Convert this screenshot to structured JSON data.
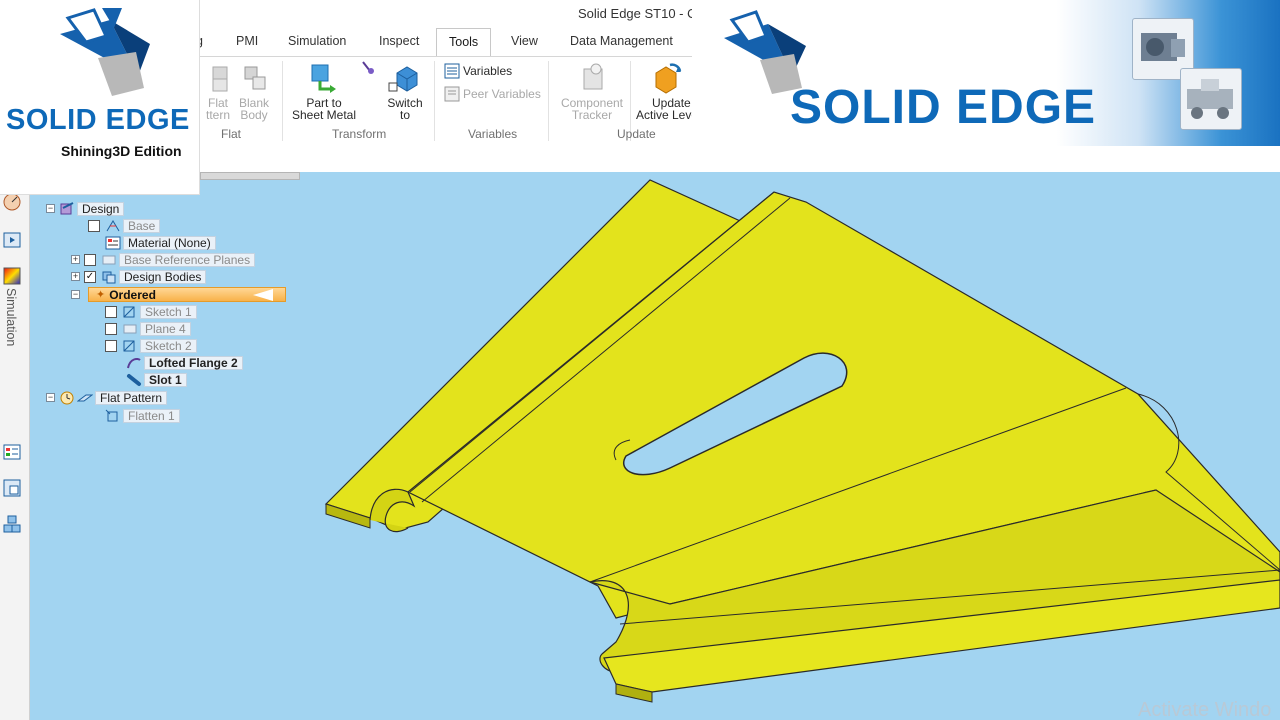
{
  "window": {
    "title": "Solid Edge ST10 - O"
  },
  "tabs": [
    {
      "label": "g",
      "active": false
    },
    {
      "label": "PMI",
      "active": false
    },
    {
      "label": "Simulation",
      "active": false
    },
    {
      "label": "Inspect",
      "active": false
    },
    {
      "label": "Tools",
      "active": true
    },
    {
      "label": "View",
      "active": false
    },
    {
      "label": "Data Management",
      "active": false
    }
  ],
  "ribbon": {
    "flat_group": {
      "flat_pattern_line1": "Flat",
      "flat_pattern_line2": "ttern",
      "blank_body_line1": "Blank",
      "blank_body_line2": "Body",
      "group_label": "Flat"
    },
    "transform_group": {
      "part_to_sheet_line1": "Part to",
      "part_to_sheet_line2": "Sheet Metal",
      "switch_to_line1": "Switch",
      "switch_to_line2": "to",
      "group_label": "Transform"
    },
    "variables_group": {
      "variables": "Variables",
      "peer_variables": "Peer Variables",
      "group_label": "Variables"
    },
    "update_group": {
      "component_tracker_line1": "Component",
      "component_tracker_line2": "Tracker",
      "update_active_line1": "Update",
      "update_active_line2": "Active Leve",
      "group_label": "Update"
    }
  },
  "logo_left": {
    "brand": "SOLID EDGE",
    "edition": "Shining3D Edition"
  },
  "banner": {
    "brand": "SOLID EDGE"
  },
  "left_strip": {
    "vertical_label": "Simulation"
  },
  "tree": {
    "design": "Design",
    "base": "Base",
    "material": "Material (None)",
    "base_reference_planes": "Base Reference Planes",
    "design_bodies": "Design Bodies",
    "ordered": "Ordered",
    "sketch1": "Sketch 1",
    "plane4": "Plane 4",
    "sketch2": "Sketch 2",
    "lofted_flange": "Lofted Flange 2",
    "slot": "Slot 1",
    "flat_pattern": "Flat Pattern",
    "flatten": "Flatten 1"
  },
  "watermark": "Activate Windo",
  "colors": {
    "viewport_bg": "#a2d4f1",
    "part_yellow": "#e0e020",
    "brand_blue": "#0e69b8",
    "ordered_highlight": "#f8b24a"
  }
}
